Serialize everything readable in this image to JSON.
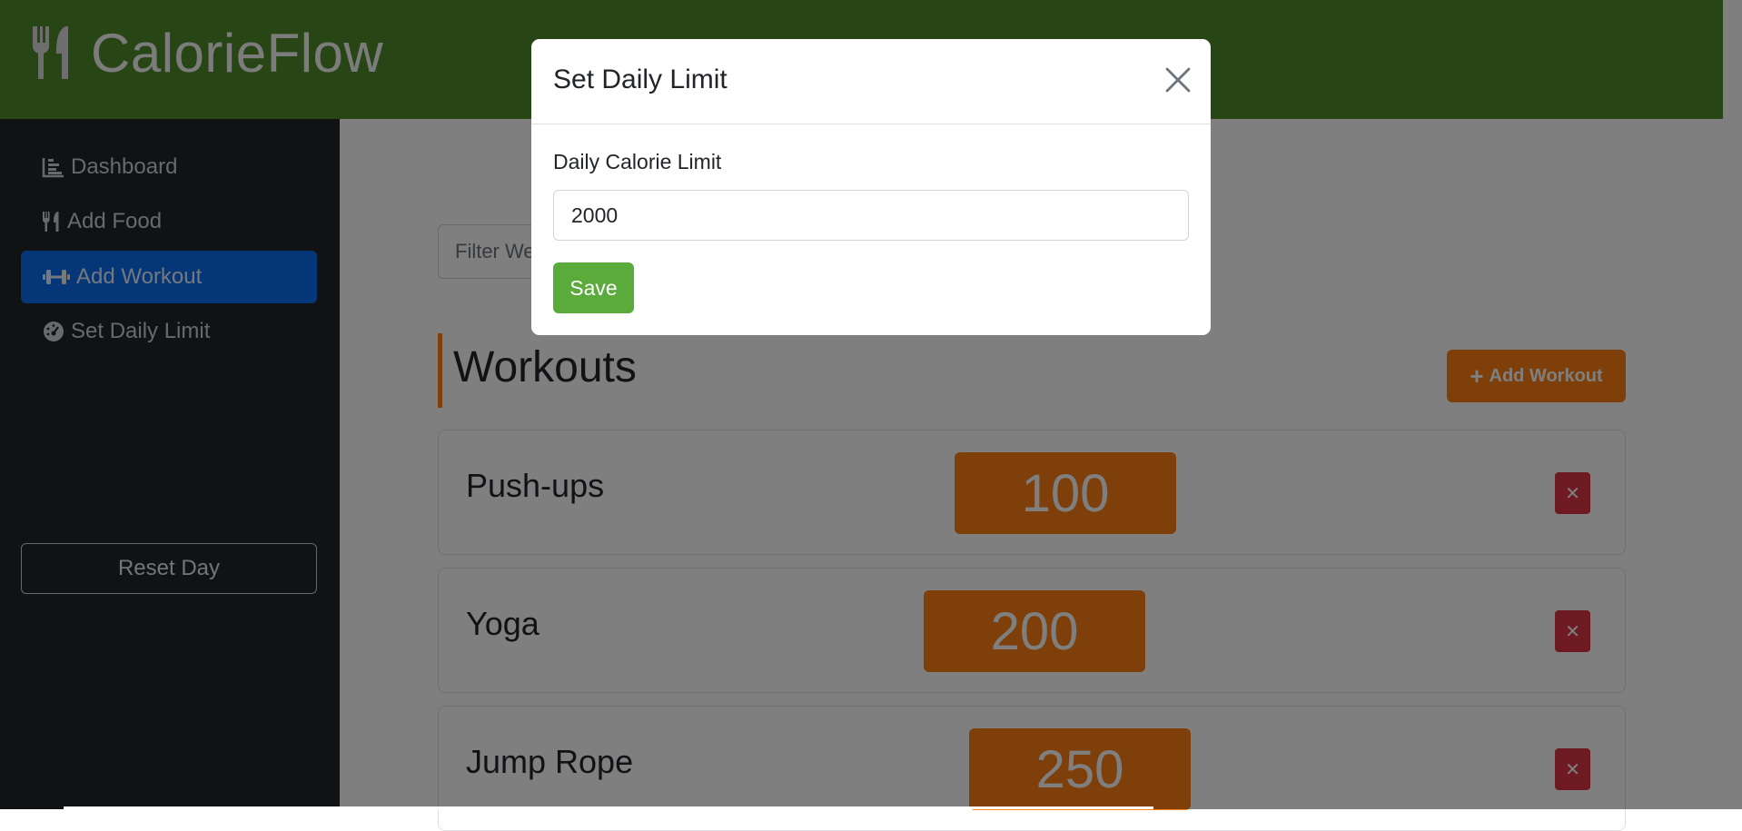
{
  "app": {
    "brand": "CalorieFlow"
  },
  "sidebar": {
    "items": [
      {
        "label": "Dashboard",
        "icon": "chart-bar-icon"
      },
      {
        "label": "Add Food",
        "icon": "utensils-icon"
      },
      {
        "label": "Add Workout",
        "icon": "dumbbell-icon",
        "active": true
      },
      {
        "label": "Set Daily Limit",
        "icon": "gauge-icon"
      }
    ],
    "reset_label": "Reset Day"
  },
  "main": {
    "filter_placeholder": "Filter We",
    "section_title": "Workouts",
    "add_workout_label": "Add Workout",
    "workouts": [
      {
        "name": "Push-ups",
        "calories": "100"
      },
      {
        "name": "Yoga",
        "calories": "200"
      },
      {
        "name": "Jump Rope",
        "calories": "250"
      }
    ],
    "delete_symbol": "✕"
  },
  "modal": {
    "title": "Set Daily Limit",
    "field_label": "Daily Calorie Limit",
    "field_value": "2000",
    "save_label": "Save"
  },
  "colors": {
    "header": "#4f8a2a",
    "sidebar": "#212529",
    "active_nav": "#0a6ef0",
    "accent_orange": "#fd7e14",
    "delete_red": "#dc3545",
    "save_green": "#5aaa3c"
  }
}
